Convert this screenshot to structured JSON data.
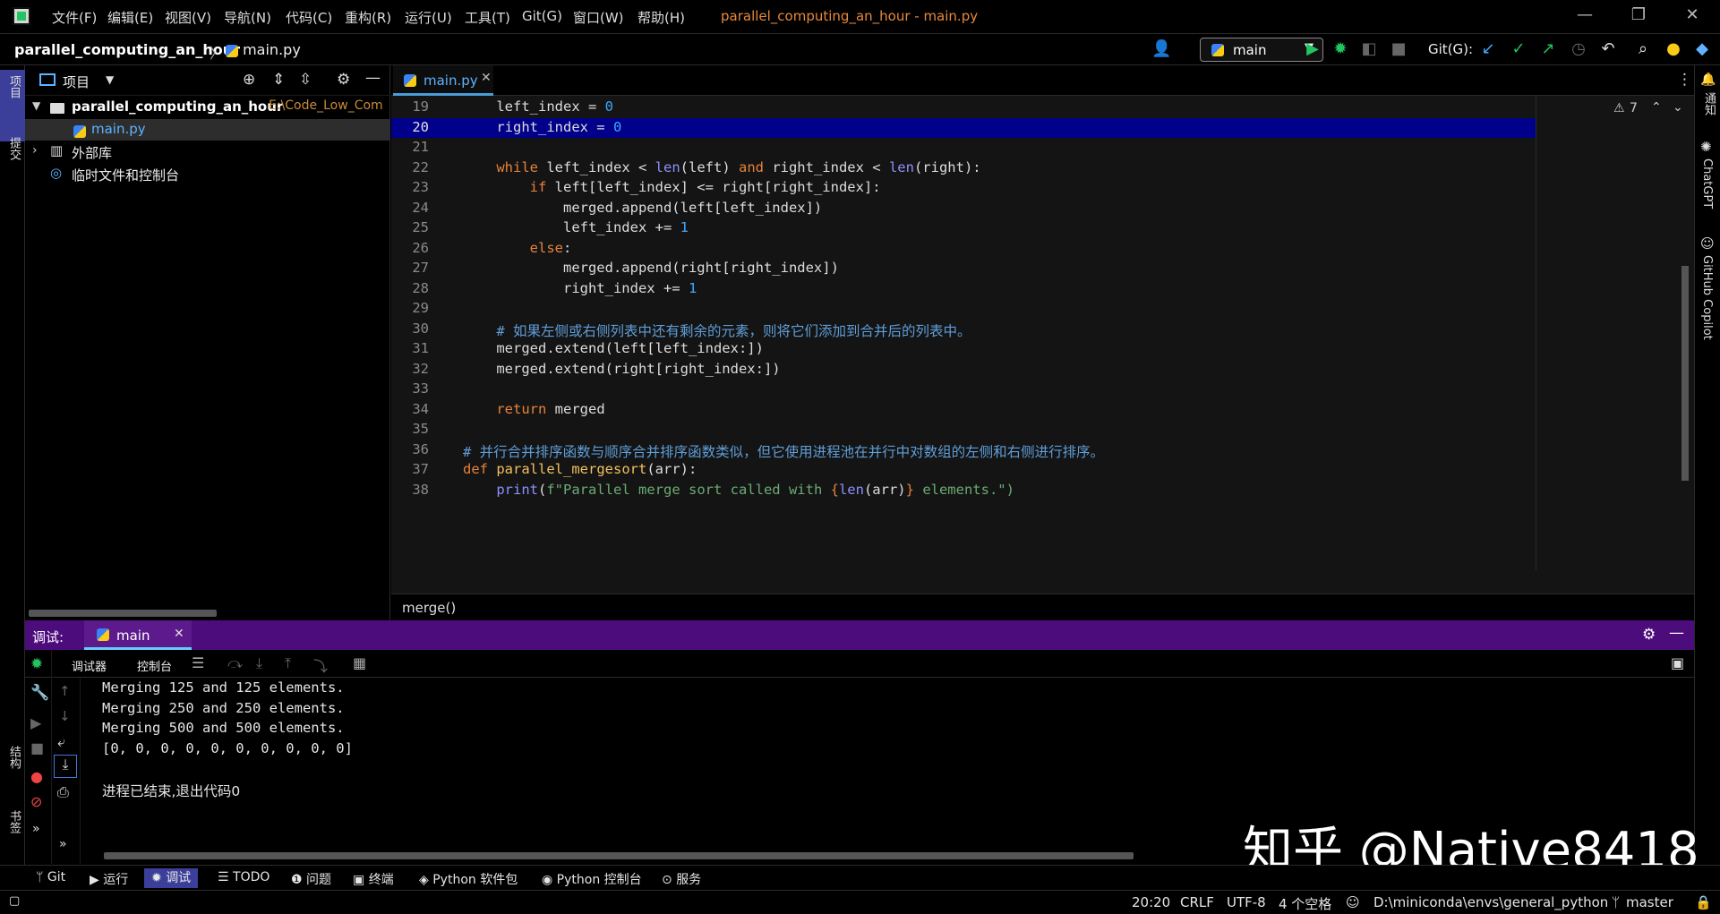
{
  "menu": [
    "文件(F)",
    "编辑(E)",
    "视图(V)",
    "导航(N)",
    "代码(C)",
    "重构(R)",
    "运行(U)",
    "工具(T)",
    "Git(G)",
    "窗口(W)",
    "帮助(H)"
  ],
  "window_title": "parallel_computing_an_hour - main.py",
  "breadcrumb": {
    "project": "parallel_computing_an_hour",
    "separator": "〉",
    "file": "main.py"
  },
  "toolbar": {
    "run_config": "main",
    "git_label": "Git(G):"
  },
  "left_strip": {
    "project": "项目",
    "commit": "提交",
    "structure": "结构",
    "bookmarks": "书签"
  },
  "right_strip": {
    "notifications": "通知",
    "chatgpt": "ChatGPT",
    "copilot": "GitHub Copilot"
  },
  "project_panel": {
    "title": "项目",
    "items": [
      {
        "label": "parallel_computing_an_hour",
        "path": "E:\\Code_Low_Com"
      },
      {
        "label": "main.py"
      },
      {
        "label": "外部库"
      },
      {
        "label": "临时文件和控制台"
      }
    ]
  },
  "editor": {
    "tab": "main.py",
    "warnings": "7",
    "breadcrumb": "merge()",
    "lines": [
      {
        "n": "19",
        "tokens": [
          {
            "t": "    left_index = "
          },
          {
            "t": "0",
            "c": "num"
          }
        ]
      },
      {
        "n": "20",
        "tokens": [
          {
            "t": "    right_index = "
          },
          {
            "t": "0",
            "c": "num"
          }
        ]
      },
      {
        "n": "21",
        "tokens": []
      },
      {
        "n": "22",
        "tokens": [
          {
            "t": "    "
          },
          {
            "t": "while",
            "c": "kw"
          },
          {
            "t": " left_index < "
          },
          {
            "t": "len",
            "c": "bi"
          },
          {
            "t": "(left) "
          },
          {
            "t": "and",
            "c": "kw"
          },
          {
            "t": " right_index < "
          },
          {
            "t": "len",
            "c": "bi"
          },
          {
            "t": "(right):"
          }
        ]
      },
      {
        "n": "23",
        "tokens": [
          {
            "t": "        "
          },
          {
            "t": "if",
            "c": "kw"
          },
          {
            "t": " left[left_index] <= right[right_index]:"
          }
        ]
      },
      {
        "n": "24",
        "tokens": [
          {
            "t": "            merged.append(left[left_index])"
          }
        ]
      },
      {
        "n": "25",
        "tokens": [
          {
            "t": "            left_index += "
          },
          {
            "t": "1",
            "c": "num"
          }
        ]
      },
      {
        "n": "26",
        "tokens": [
          {
            "t": "        "
          },
          {
            "t": "else",
            "c": "kw"
          },
          {
            "t": ":"
          }
        ]
      },
      {
        "n": "27",
        "tokens": [
          {
            "t": "            merged.append(right[right_index])"
          }
        ]
      },
      {
        "n": "28",
        "tokens": [
          {
            "t": "            right_index += "
          },
          {
            "t": "1",
            "c": "num"
          }
        ]
      },
      {
        "n": "29",
        "tokens": []
      },
      {
        "n": "30",
        "tokens": [
          {
            "t": "    # 如果左侧或右侧列表中还有剩余的元素，则将它们添加到合并后的列表中。",
            "c": "cm"
          }
        ]
      },
      {
        "n": "31",
        "tokens": [
          {
            "t": "    merged.extend(left[left_index:])"
          }
        ]
      },
      {
        "n": "32",
        "tokens": [
          {
            "t": "    merged.extend(right[right_index:])"
          }
        ]
      },
      {
        "n": "33",
        "tokens": []
      },
      {
        "n": "34",
        "tokens": [
          {
            "t": "    "
          },
          {
            "t": "return",
            "c": "kw"
          },
          {
            "t": " merged"
          }
        ]
      },
      {
        "n": "35",
        "tokens": []
      },
      {
        "n": "36",
        "tokens": [
          {
            "t": "# 并行合并排序函数与顺序合并排序函数类似，但它使用进程池在并行中对数组的左侧和右侧进行排序。",
            "c": "cm"
          }
        ]
      },
      {
        "n": "37",
        "tokens": [
          {
            "t": "def",
            "c": "kw"
          },
          {
            "t": " "
          },
          {
            "t": "parallel_mergesort",
            "c": "fn"
          },
          {
            "t": "(arr):"
          }
        ]
      },
      {
        "n": "38",
        "tokens": [
          {
            "t": "    "
          },
          {
            "t": "print",
            "c": "bi"
          },
          {
            "t": "("
          },
          {
            "t": "f\"Parallel merge sort called with ",
            "c": "st"
          },
          {
            "t": "{",
            "c": "kw"
          },
          {
            "t": "len",
            "c": "bi"
          },
          {
            "t": "(arr)"
          },
          {
            "t": "}",
            "c": "kw"
          },
          {
            "t": " elements.\")",
            "c": "st"
          }
        ]
      }
    ]
  },
  "debug": {
    "title": "调试:",
    "tab": "main",
    "subtabs": [
      "调试器",
      "控制台"
    ],
    "output": [
      "Merging 125 and 125 elements.",
      "Merging 250 and 250 elements.",
      "Merging 500 and 500 elements.",
      "[0, 0, 0, 0, 0, 0, 0, 0, 0, 0]",
      "",
      "进程已结束,退出代码0"
    ]
  },
  "bottom_tools": [
    "Git",
    "运行",
    "调试",
    "TODO",
    "问题",
    "终端",
    "Python 软件包",
    "Python 控制台",
    "服务"
  ],
  "status": {
    "position": "20:20",
    "line_sep": "CRLF",
    "encoding": "UTF-8",
    "indent": "4 个空格",
    "interpreter": "D:\\miniconda\\envs\\general_python",
    "branch": "master"
  },
  "watermark": "知乎 @Native8418",
  "colors": {
    "accent": "#3c3f9a",
    "debug_header": "#4c0c7c",
    "highlight_line": "#00008a"
  }
}
